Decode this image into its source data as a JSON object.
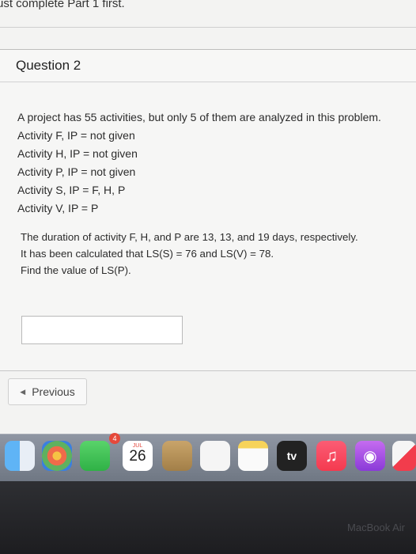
{
  "page": {
    "top_note": "ust complete Part 1 first."
  },
  "question": {
    "title": "Question 2",
    "lines": [
      "A project has 55 activities, but only 5 of them are analyzed in this problem.",
      "Activity F, IP  =  not given",
      "Activity H, IP  =  not given",
      "Activity P, IP  =  not given",
      "Activity S, IP  =  F, H, P",
      "Activity V, IP  =  P"
    ],
    "body": [
      "The duration of activity F, H, and P are 13, 13, and 19 days, respectively.",
      "It has been calculated that LS(S) = 76 and LS(V) = 78.",
      "Find the value of LS(P)."
    ],
    "answer_value": ""
  },
  "nav": {
    "previous_label": "Previous"
  },
  "dock": {
    "calendar_month": "JUL",
    "calendar_day": "26",
    "facetime_badge": "4",
    "tv_label": "tv",
    "icons": [
      "finder-icon",
      "photos-icon",
      "facetime-icon",
      "calendar-icon",
      "contacts-icon",
      "reminders-icon",
      "notes-icon",
      "apple-tv-icon",
      "music-icon",
      "podcasts-icon",
      "news-icon"
    ]
  },
  "device": {
    "label": "MacBook Air"
  }
}
